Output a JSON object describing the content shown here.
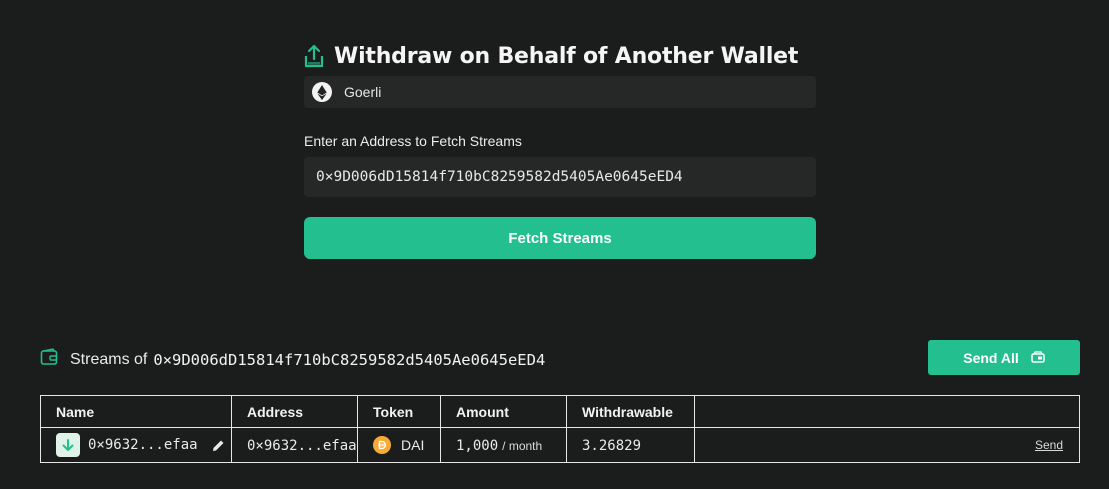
{
  "header": {
    "title": "Withdraw on Behalf of Another Wallet",
    "title_icon": "upload-tray-icon"
  },
  "network": {
    "name": "Goerli",
    "icon": "ethereum-icon"
  },
  "form": {
    "address_label": "Enter an Address to Fetch Streams",
    "address_value": "0×9D006dD15814f710bC8259582d5405Ae0645eED4",
    "fetch_button": "Fetch Streams"
  },
  "streams": {
    "label": "Streams of",
    "address": "0×9D006dD15814f710bC8259582d5405Ae0645eED4",
    "send_all_button": "Send All",
    "columns": [
      "Name",
      "Address",
      "Token",
      "Amount",
      "Withdrawable",
      ""
    ],
    "rows": [
      {
        "name": "0×9632...efaa",
        "address": "0×9632...efaa",
        "token": "DAI",
        "amount": "1,000",
        "period": "/ month",
        "withdrawable": "3.26829",
        "action": "Send"
      }
    ]
  },
  "colors": {
    "background": "#1b1c1c",
    "accent": "#23bf8f",
    "input_bg": "#262727"
  }
}
